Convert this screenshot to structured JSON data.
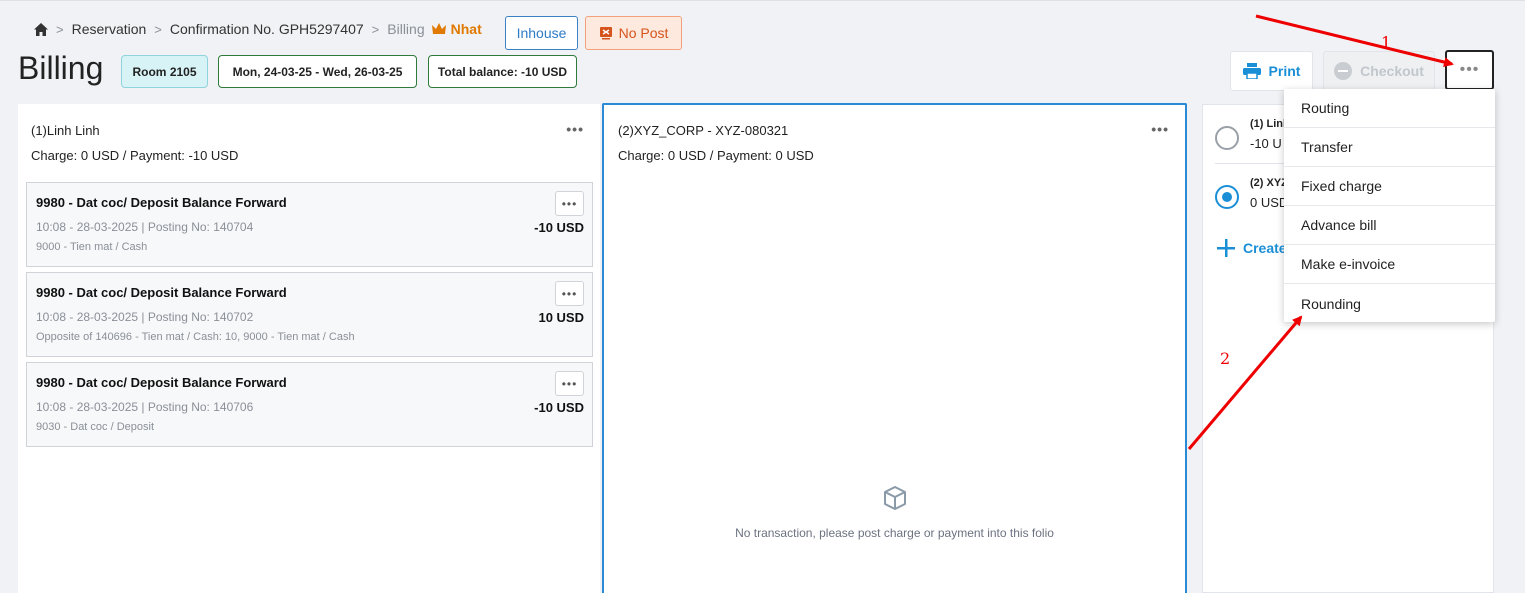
{
  "breadcrumb": {
    "reservation": "Reservation",
    "confirmation": "Confirmation No. GPH5297407",
    "billing": "Billing",
    "user": "Nhat"
  },
  "status": {
    "inhouse": "Inhouse",
    "no_post": "No Post"
  },
  "header": {
    "title": "Billing",
    "room": "Room 2105",
    "dates": "Mon, 24-03-25 - Wed, 26-03-25",
    "balance": "Total balance: -10 USD",
    "print": "Print",
    "checkout": "Checkout"
  },
  "folio1": {
    "name": "(1)Linh Linh",
    "summary": "Charge: 0 USD / Payment: -10 USD",
    "transactions": [
      {
        "title": "9980 - Dat coc/ Deposit Balance Forward",
        "meta": "10:08 - 28-03-2025 | Posting No: 140704",
        "note": "9000 - Tien mat / Cash",
        "amount": "-10 USD"
      },
      {
        "title": "9980 - Dat coc/ Deposit Balance Forward",
        "meta": "10:08 - 28-03-2025 | Posting No: 140702",
        "note": "Opposite of 140696 - Tien mat / Cash: 10, 9000 - Tien mat / Cash",
        "amount": "10 USD"
      },
      {
        "title": "9980 - Dat coc/ Deposit Balance Forward",
        "meta": "10:08 - 28-03-2025 | Posting No: 140706",
        "note": "9030 - Dat coc / Deposit",
        "amount": "-10 USD"
      }
    ]
  },
  "folio2": {
    "name": "(2)XYZ_CORP - XYZ-080321",
    "summary": "Charge: 0 USD / Payment: 0 USD",
    "empty": "No transaction, please post charge or payment into this folio"
  },
  "folio_list": {
    "items": [
      {
        "name": "(1) Linh",
        "value": "-10 U",
        "selected": false
      },
      {
        "name": "(2) XYZ",
        "value": "0 USD",
        "selected": true
      }
    ],
    "create": "Create"
  },
  "menu": {
    "items": [
      "Routing",
      "Transfer",
      "Fixed charge",
      "Advance bill",
      "Make e-invoice",
      "Rounding"
    ]
  },
  "annotations": {
    "one": "1",
    "two": "2"
  },
  "colors": {
    "accent": "#1a8fd6",
    "annotation": "#ee0000",
    "nopost": "#d4541c",
    "inhouse": "#2e7bc6"
  }
}
